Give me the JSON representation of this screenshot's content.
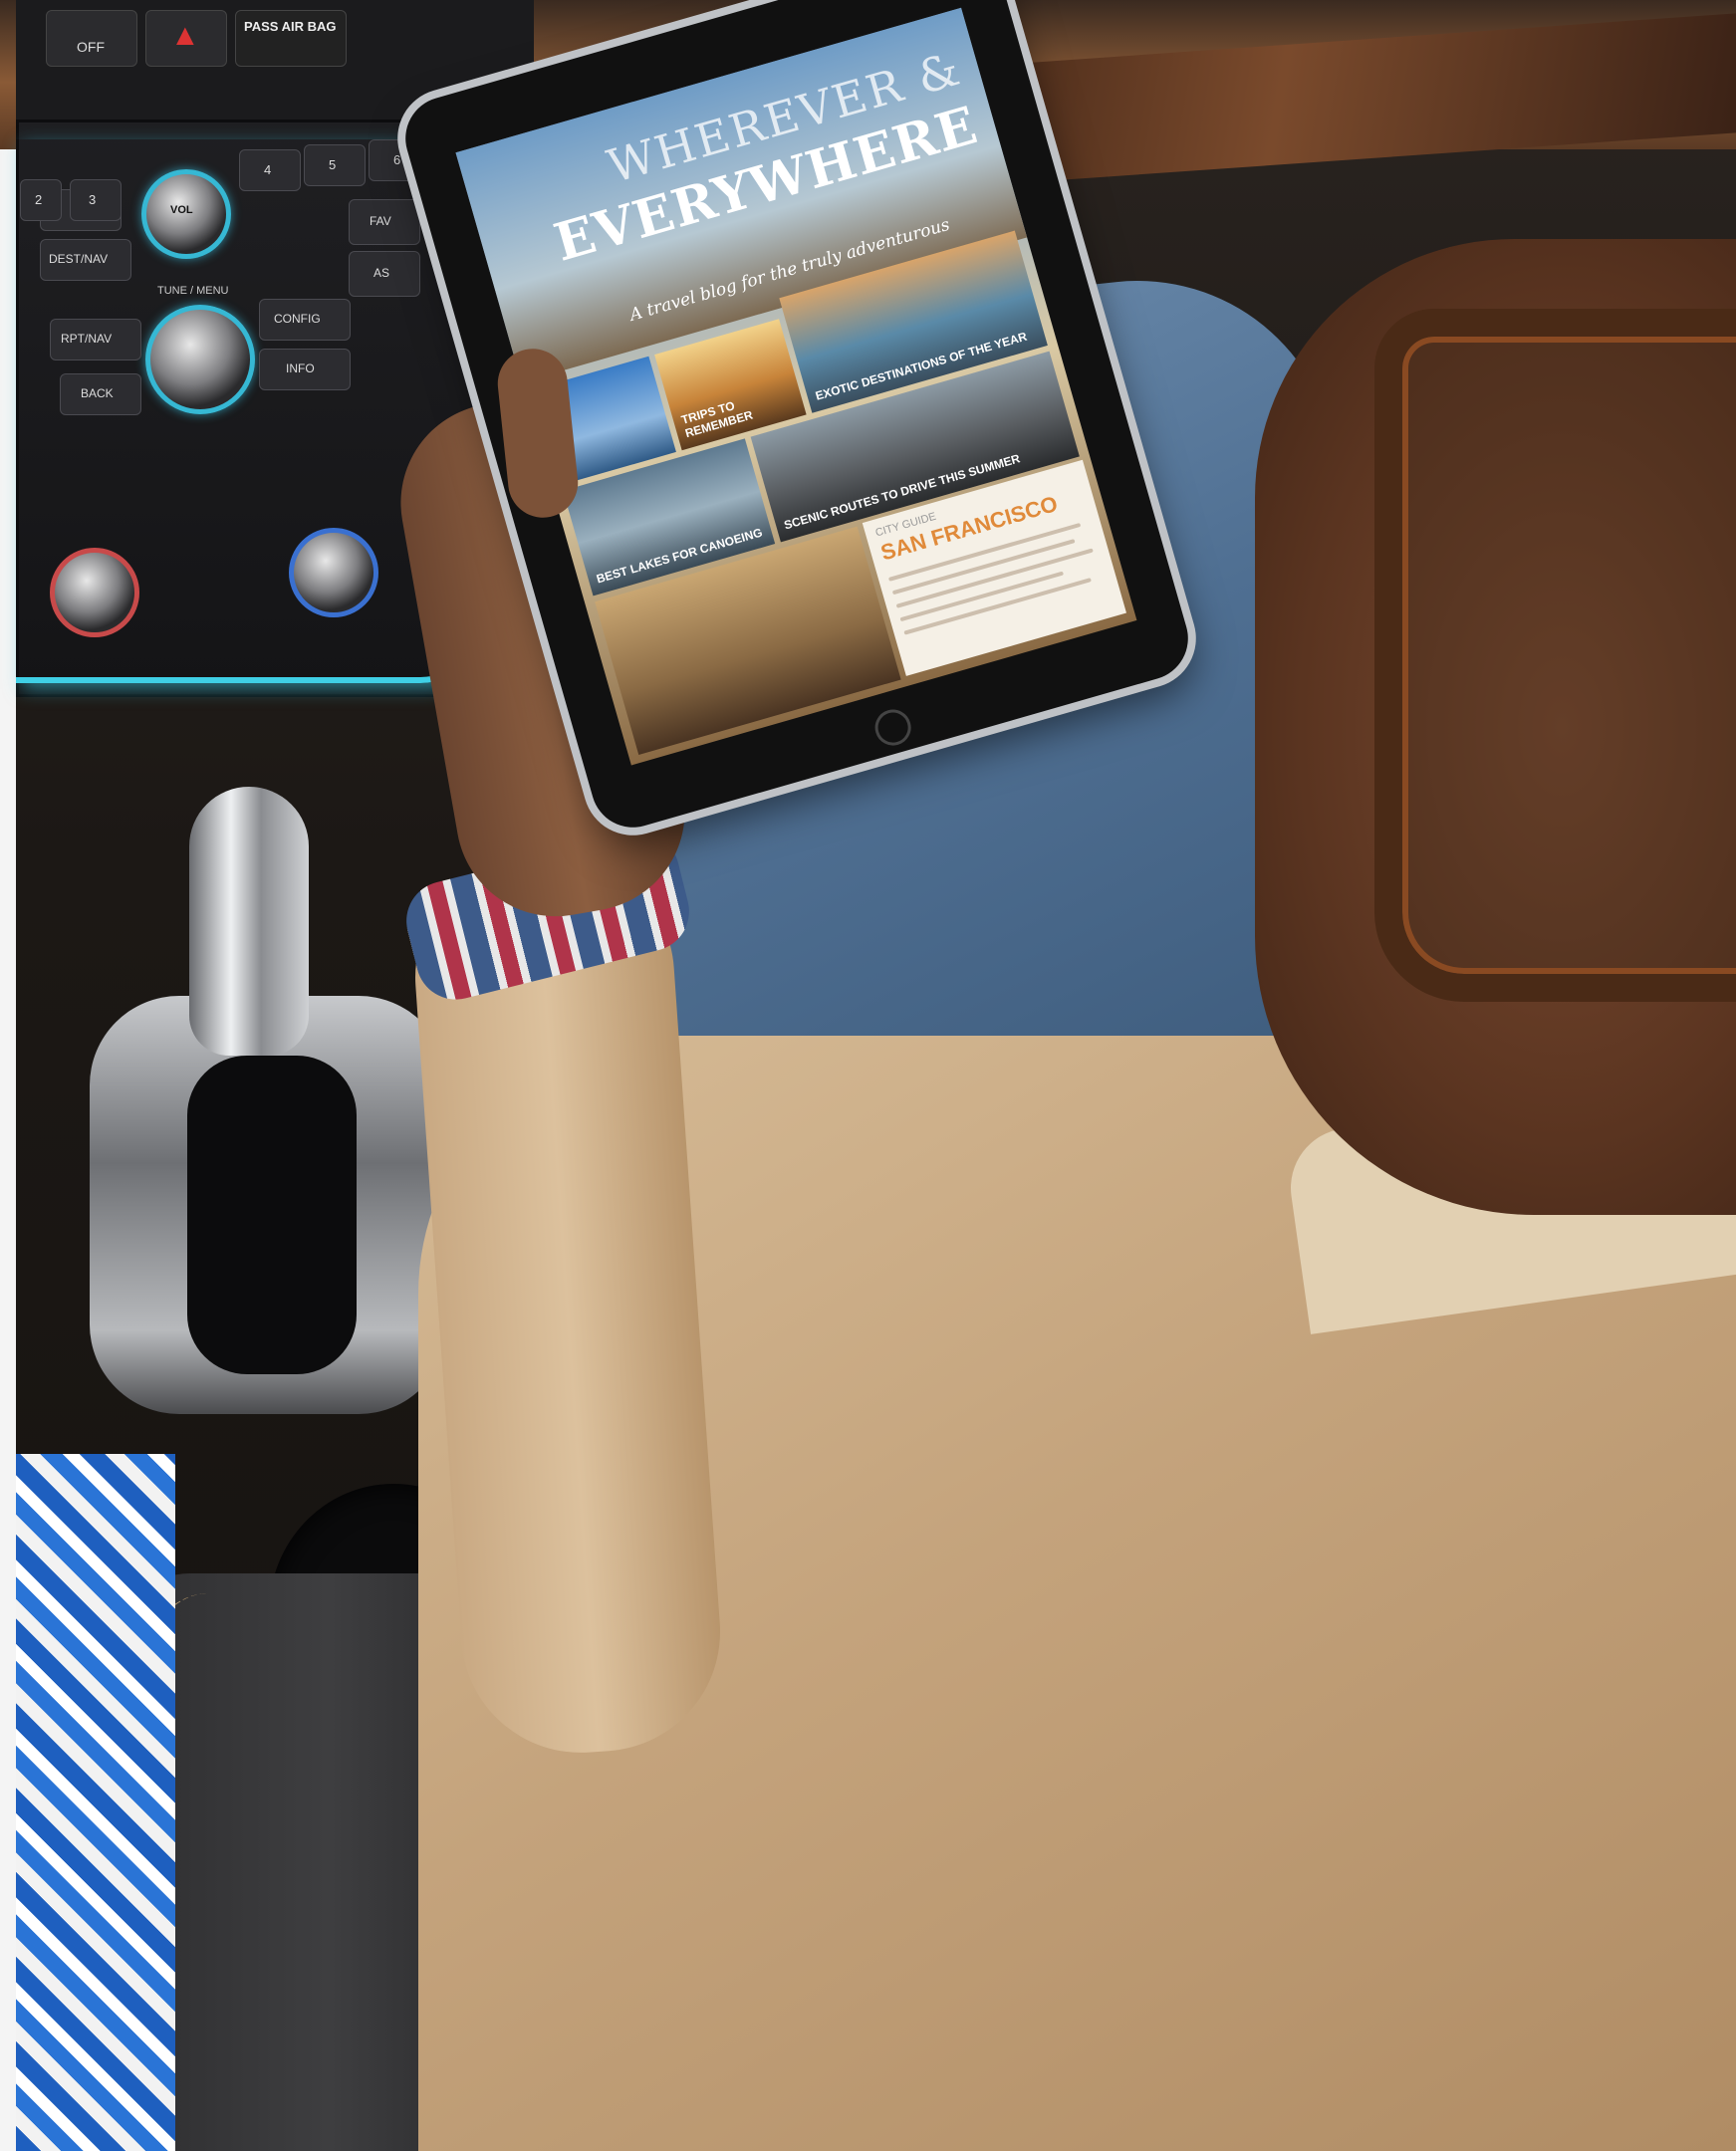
{
  "dashboard": {
    "airbag_label": "PASS AIR BAG",
    "airbag_off": "OFF"
  },
  "radio": {
    "vol": "VOL",
    "tune_menu": "TUNE / MENU",
    "dest_nav": "DEST/NAV",
    "rpt_nav": "RPT/NAV",
    "back": "BACK",
    "config": "CONFIG",
    "info": "INFO",
    "fav": "FAV",
    "as": "AS",
    "presets": [
      "2",
      "3",
      "4",
      "5",
      "6"
    ]
  },
  "tablet": {
    "hero_title_a": "WHEREVER &",
    "hero_title_b": "EVERYWHERE",
    "hero_subtitle": "A travel blog for the truly adventurous",
    "tiles": [
      {
        "kicker": "",
        "label": ""
      },
      {
        "kicker": "",
        "label": "TRIPS TO REMEMBER"
      },
      {
        "kicker": "",
        "label": "EXOTIC DESTINATIONS OF THE YEAR"
      },
      {
        "kicker": "",
        "label": "BEST LAKES FOR CANOEING"
      },
      {
        "kicker": "",
        "label": "SCENIC ROUTES TO DRIVE THIS SUMMER"
      }
    ],
    "city_kicker": "CITY GUIDE",
    "city_name": "SAN FRANCISCO"
  }
}
